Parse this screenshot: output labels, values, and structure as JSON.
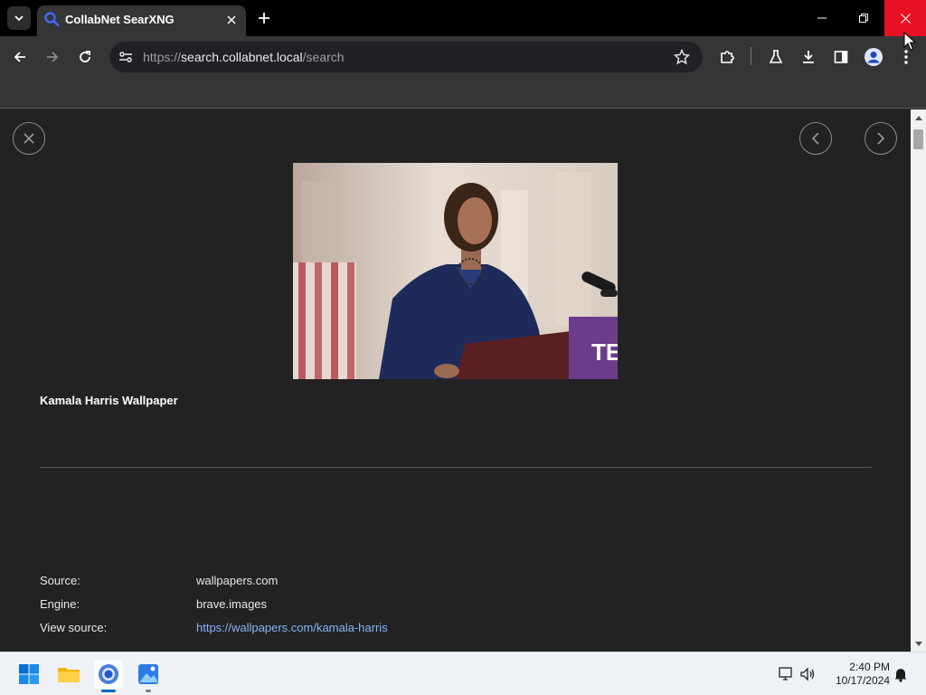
{
  "browser": {
    "tab": {
      "title": "CollabNet SearXNG"
    },
    "address": {
      "scheme": "https://",
      "host": "search.collabnet.local",
      "path": "/search"
    }
  },
  "content": {
    "image_title": "Kamala Harris Wallpaper",
    "meta": {
      "source_label": "Source:",
      "source_value": "wallpapers.com",
      "engine_label": "Engine:",
      "engine_value": "brave.images",
      "view_label": "View source:",
      "view_value": "https://wallpapers.com/kamala-harris"
    },
    "podium_sign": "TE"
  },
  "taskbar": {
    "time": "2:40 PM",
    "date": "10/17/2024",
    "apps": [
      "start-icon",
      "file-explorer-icon",
      "chrome-icon",
      "photos-icon"
    ]
  },
  "colors": {
    "accent_close": "#e81123",
    "link": "#8ab4f8",
    "page_bg": "#222222"
  }
}
